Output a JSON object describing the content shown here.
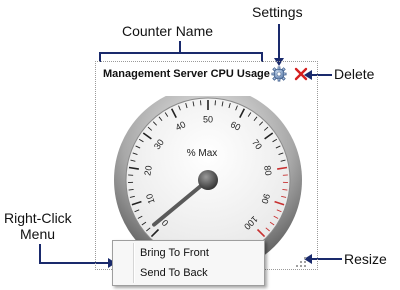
{
  "callouts": {
    "counter_name": "Counter Name",
    "settings": "Settings",
    "delete": "Delete",
    "right_click_line1": "Right-Click",
    "right_click_line2": "Menu",
    "resize": "Resize"
  },
  "widget": {
    "title": "Management Server CPU Usage",
    "gauge": {
      "label": "% Max",
      "min": 0,
      "max": 100,
      "major_step": 10,
      "minor_step": 2,
      "tick_labels": [
        "0",
        "10",
        "20",
        "30",
        "40",
        "50",
        "60",
        "70",
        "80",
        "90",
        "100"
      ],
      "value": 2,
      "red_zone_start": 80
    }
  },
  "context_menu": {
    "items": [
      {
        "label": "Bring To Front"
      },
      {
        "label": "Send To Back"
      }
    ]
  },
  "icons": {
    "settings": "gear-icon",
    "delete": "close-icon",
    "resize": "resize-grip-icon"
  },
  "colors": {
    "annotation_line": "#1a2a6c",
    "delete_red": "#d42020",
    "gauge_red_zone": "#c83030"
  }
}
